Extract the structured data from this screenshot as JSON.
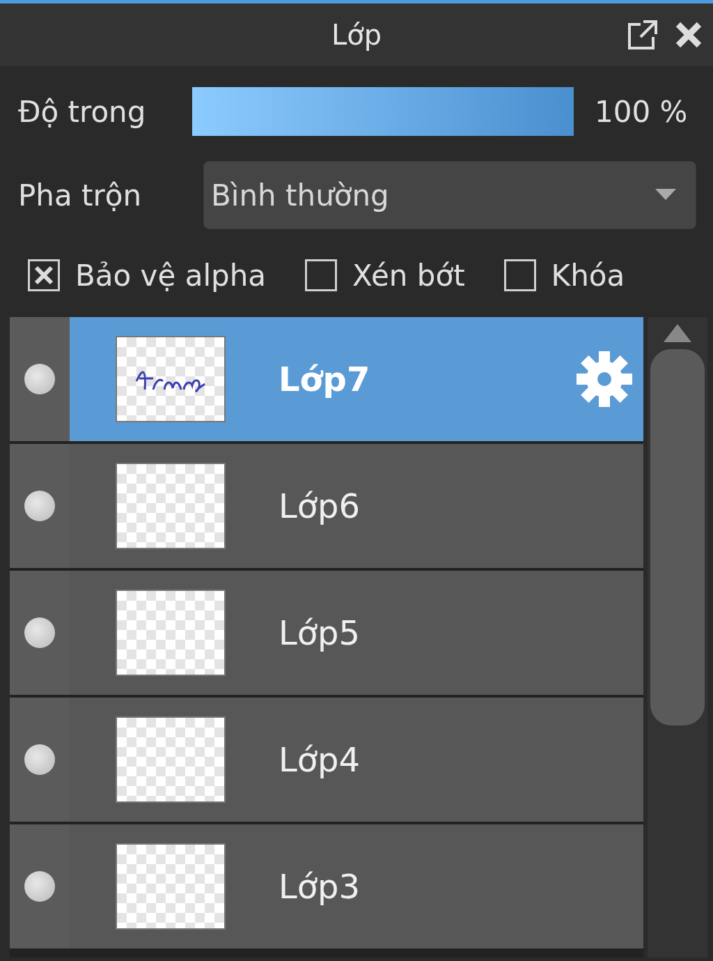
{
  "panel": {
    "title": "Lớp"
  },
  "opacity": {
    "label": "Độ trong",
    "level": 1,
    "reading": "100 %"
  },
  "blend": {
    "label": "Pha trộn",
    "value": "Bình thường"
  },
  "options": [
    {
      "label": "Bảo vệ alpha",
      "checked": true
    },
    {
      "label": "Xén bớt",
      "checked": false
    },
    {
      "label": "Khóa",
      "checked": false
    }
  ],
  "layers": [
    {
      "name": "Lớp7",
      "selected": true,
      "kind": "drawn"
    },
    {
      "name": "Lớp6",
      "selected": false,
      "kind": "empty"
    },
    {
      "name": "Lớp5",
      "selected": false,
      "kind": "empty"
    },
    {
      "name": "Lớp4",
      "selected": false,
      "kind": "empty"
    },
    {
      "name": "Lớp3",
      "selected": false,
      "kind": "empty"
    }
  ]
}
